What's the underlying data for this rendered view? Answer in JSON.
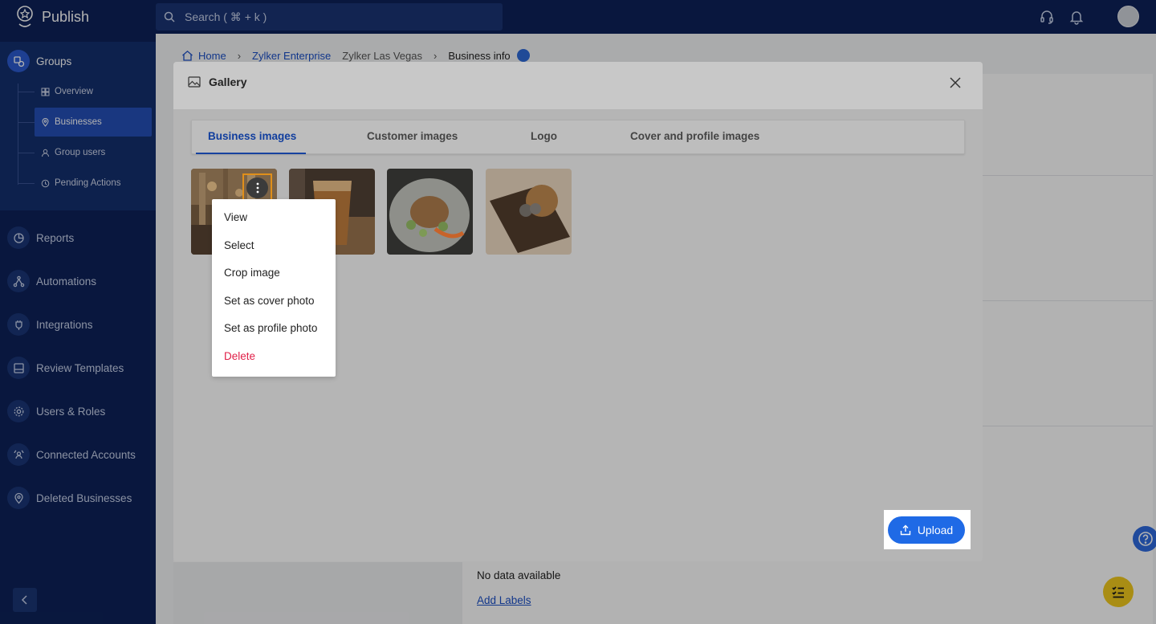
{
  "app": {
    "name": "Publish"
  },
  "search": {
    "placeholder": "Search ( ⌘ + k )"
  },
  "sidebar": {
    "groups_label": "Groups",
    "sub_items": [
      {
        "label": "Overview",
        "icon": "grid-icon"
      },
      {
        "label": "Businesses",
        "icon": "location-pin-icon",
        "active": true
      },
      {
        "label": "Group users",
        "icon": "users-icon"
      },
      {
        "label": "Pending Actions",
        "icon": "clock-icon"
      }
    ],
    "items": [
      {
        "label": "Reports",
        "icon": "pie-chart-icon"
      },
      {
        "label": "Automations",
        "icon": "flow-icon"
      },
      {
        "label": "Integrations",
        "icon": "plug-icon"
      },
      {
        "label": "Review Templates",
        "icon": "template-icon"
      },
      {
        "label": "Users & Roles",
        "icon": "gear-icon"
      },
      {
        "label": "Connected Accounts",
        "icon": "linked-users-icon"
      },
      {
        "label": "Deleted Businesses",
        "icon": "deleted-pin-icon"
      }
    ]
  },
  "breadcrumb": {
    "home": "Home",
    "enterprise": "Zylker Enterprise",
    "location": "Zylker Las Vegas",
    "current": "Business info"
  },
  "page": {
    "no_data": "No data available",
    "add_labels": "Add Labels"
  },
  "modal": {
    "title": "Gallery",
    "tabs": [
      "Business images",
      "Customer images",
      "Logo",
      "Cover and profile images"
    ],
    "active_tab": "Business images",
    "upload_label": "Upload"
  },
  "context_menu": {
    "items": [
      "View",
      "Select",
      "Crop image",
      "Set as cover photo",
      "Set as profile photo",
      "Delete"
    ]
  },
  "colors": {
    "navy": "#0d2259",
    "accent_blue": "#1f6ae6",
    "active_tab": "#113e9e",
    "danger": "#e02048",
    "highlight_outline": "#e08f1a"
  }
}
